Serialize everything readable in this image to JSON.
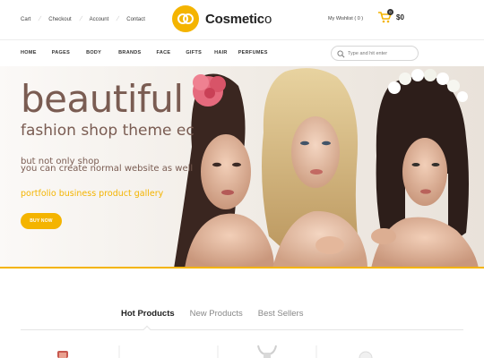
{
  "topbar": {
    "links": [
      "Cart",
      "Checkout",
      "Account",
      "Contact"
    ],
    "wishlist": "My Wishlist ( 0 )",
    "cart_count": "0",
    "cart_total": "$0"
  },
  "brand": {
    "name_bold": "Cosmetic",
    "name_light": "o"
  },
  "nav": {
    "items": [
      "HOME",
      "PAGES",
      "BODY",
      "BRANDS",
      "FACE",
      "GIFTS",
      "HAIR",
      "PERFUMES"
    ],
    "search_placeholder": "Type and hit enter"
  },
  "hero": {
    "title": "beautiful",
    "subtitle": "fashion shop theme  ec",
    "text_line1": "but not only shop",
    "text_line2": "you can create normal website as well",
    "links": "portfolio  business  product  gallery",
    "button": "BUY NOW"
  },
  "products": {
    "tabs": [
      "Hot Products",
      "New Products",
      "Best Sellers"
    ]
  },
  "colors": {
    "accent": "#f4b400",
    "hero_text": "#7a5c52"
  }
}
